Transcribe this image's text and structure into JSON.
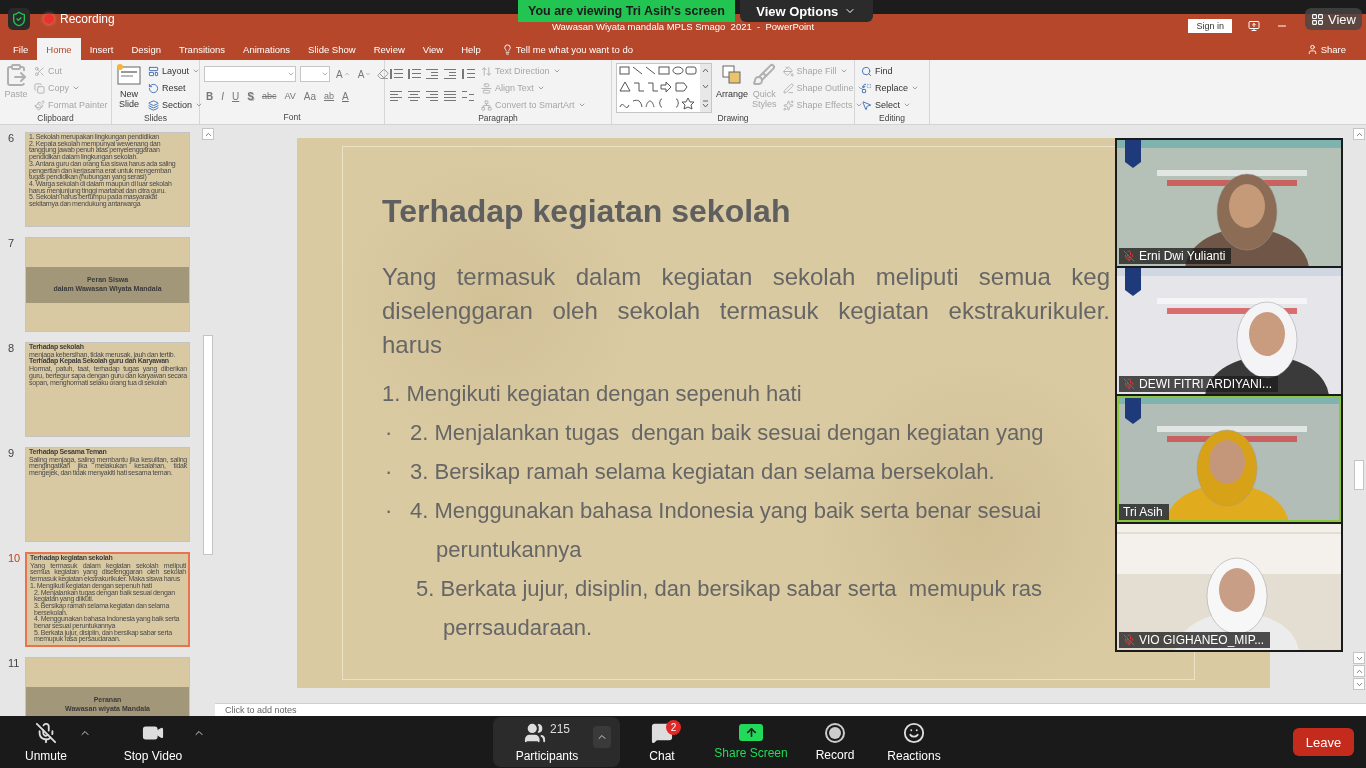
{
  "zoom_banner": {
    "viewing": "You are viewing Tri Asih's screen",
    "view_options": "View Options"
  },
  "recording": {
    "label": "Recording"
  },
  "view_button": {
    "label": "View"
  },
  "title_bar": {
    "title": "Wawasan Wiyata mandala MPLS Smago  2021  -  PowerPoint",
    "sign_in": "Sign in"
  },
  "menu_tabs": [
    {
      "label": "File",
      "selected": false
    },
    {
      "label": "Home",
      "selected": true
    },
    {
      "label": "Insert",
      "selected": false
    },
    {
      "label": "Design",
      "selected": false
    },
    {
      "label": "Transitions",
      "selected": false
    },
    {
      "label": "Animations",
      "selected": false
    },
    {
      "label": "Slide Show",
      "selected": false
    },
    {
      "label": "Review",
      "selected": false
    },
    {
      "label": "View",
      "selected": false
    },
    {
      "label": "Help",
      "selected": false
    }
  ],
  "tell_me": {
    "label": "Tell me what you want to do"
  },
  "share": {
    "label": "Share"
  },
  "ribbon": {
    "groups": [
      {
        "kind": "clipboard",
        "label": "Clipboard",
        "large": [
          {
            "kind": "paste",
            "label": "Paste",
            "disabled": true
          }
        ],
        "small": [
          {
            "kind": "cut",
            "label": "Cut",
            "disabled": true,
            "menu": false
          },
          {
            "kind": "copy",
            "label": "Copy",
            "disabled": true,
            "menu": true
          },
          {
            "kind": "format_painter",
            "label": "Format Painter",
            "disabled": true,
            "menu": false
          }
        ]
      },
      {
        "kind": "slides",
        "label": "Slides",
        "large": [
          {
            "kind": "new_slide",
            "label": "New Slide",
            "disabled": false
          }
        ],
        "small": [
          {
            "kind": "layout",
            "label": "Layout",
            "disabled": false,
            "menu": true
          },
          {
            "kind": "reset",
            "label": "Reset",
            "disabled": false,
            "menu": false
          },
          {
            "kind": "section",
            "label": "Section",
            "disabled": false,
            "menu": true
          }
        ]
      },
      {
        "kind": "font",
        "label": "Font",
        "size_buttons": [
          "A",
          "A"
        ],
        "format_buttons": [
          {
            "kind": "bold",
            "label": "B"
          },
          {
            "kind": "italic",
            "label": "I"
          },
          {
            "kind": "underline",
            "label": "U"
          },
          {
            "kind": "shadow",
            "label": "S"
          },
          {
            "kind": "strike",
            "label": "abc"
          },
          {
            "kind": "spacing",
            "label": "AV"
          },
          {
            "kind": "case",
            "label": "Aa"
          },
          {
            "kind": "highlight",
            "label": "ab"
          },
          {
            "kind": "color",
            "label": "A"
          }
        ]
      },
      {
        "kind": "paragraph",
        "label": "Paragraph",
        "small": [
          {
            "kind": "text_direction",
            "label": "Text Direction",
            "disabled": true,
            "menu": true
          },
          {
            "kind": "align_text",
            "label": "Align Text",
            "disabled": true,
            "menu": true
          },
          {
            "kind": "smartart",
            "label": "Convert to SmartArt",
            "disabled": true,
            "menu": true
          }
        ]
      },
      {
        "kind": "drawing",
        "label": "Drawing",
        "large": [
          {
            "kind": "arrange",
            "label": "Arrange",
            "disabled": false
          },
          {
            "kind": "quick_styles",
            "label": "Quick Styles",
            "disabled": true
          }
        ],
        "small": [
          {
            "kind": "shape_fill",
            "label": "Shape Fill",
            "disabled": true,
            "menu": true
          },
          {
            "kind": "shape_outline",
            "label": "Shape Outline",
            "disabled": true,
            "menu": true
          },
          {
            "kind": "shape_effects",
            "label": "Shape Effects",
            "disabled": true,
            "menu": true
          }
        ]
      },
      {
        "kind": "editing",
        "label": "Editing",
        "small": [
          {
            "kind": "find",
            "label": "Find",
            "disabled": false,
            "menu": false
          },
          {
            "kind": "replace",
            "label": "Replace",
            "disabled": false,
            "menu": true
          },
          {
            "kind": "select",
            "label": "Select",
            "disabled": false,
            "menu": true
          }
        ]
      }
    ]
  },
  "thumbnails": [
    {
      "number": "6",
      "selected": false,
      "kind": "content",
      "blocks": [
        {
          "kind": "item",
          "text": "1. Sekolah merupakan lingkungan pendidikan"
        },
        {
          "kind": "item",
          "text": "2. Kepala sekolah mempunyai wewenang dan tanggung jawab penuh atas    penyelenggaraan pendidikan dalam lingkungan sekolah."
        },
        {
          "kind": "item",
          "text": "3. Antara guru dan orang tua siswa harus ada saling pengertian dan kerjasama erat untuk mengemban tugas pendidikan (hubungan yang serasi)"
        },
        {
          "kind": "item",
          "text": "4. Warga sekolah di dalam maupun di luar sekolah harus menjunjung tinggi martabat dan citra guru."
        },
        {
          "kind": "item",
          "text": "5. Sekolah harus bertumpu pada masyarakat sekitarnya dan mendukung antarwarga"
        }
      ]
    },
    {
      "number": "7",
      "selected": false,
      "kind": "section",
      "blocks": [
        {
          "kind": "heading",
          "text": "Peran Siswa"
        },
        {
          "kind": "heading",
          "text": "dalam Wawasan Wiyata Mandala"
        }
      ]
    },
    {
      "number": "8",
      "selected": false,
      "kind": "content",
      "blocks": [
        {
          "kind": "heading",
          "text": "Terhadap sekolah"
        },
        {
          "kind": "body",
          "text": "menjaga kebersihan, tidak merusak, jauh dan tertib."
        },
        {
          "kind": "heading",
          "text": "Terhadap Kepala Sekolah guru dan Karyawan"
        },
        {
          "kind": "body",
          "text": "Hormat, patuh, taat, terhadap tugas yang diberikan guru, bertegur sapa dengan guru dan karyawan secara sopan, menghormati selaku orang tua di sekolah"
        }
      ]
    },
    {
      "number": "9",
      "selected": false,
      "kind": "content",
      "blocks": [
        {
          "kind": "heading",
          "text": "Terhadap Sesama Teman"
        },
        {
          "kind": "body",
          "text": "Saling menjaga, saling membantu jika kesulitan, saling mengingatkan jika melakukan kesalahan, tidak mengejek, dan tidak menyakiti hati sesama teman."
        }
      ]
    },
    {
      "number": "10",
      "selected": true,
      "kind": "content",
      "blocks": [
        {
          "kind": "heading",
          "text": "Terhadap kegiatan sekolah"
        },
        {
          "kind": "body",
          "text": "Yang termasuk dalam kegiatan sekolah meliputi semua kegiatan yang diselenggaran oleh sekolah termasuk kegiatan ekstrakurikuler. Maka siswa harus"
        },
        {
          "kind": "item",
          "text": "1. Mengikuti kegiatan dengan sepenuh hati"
        },
        {
          "kind": "subitem",
          "text": "2. Menjalankan tugas dengan baik sesuai dengan kegiatan yang diikuti."
        },
        {
          "kind": "subitem",
          "text": "3. Bersikap ramah selama kegiatan dan selama bersekolah."
        },
        {
          "kind": "subitem",
          "text": "4. Menggunakan bahasa Indonesia yang baik serta benar sesuai peruntukannya"
        },
        {
          "kind": "subitem",
          "text": "5. Berkata jujur, disiplin, dan bersikap sabar serta memupuk rasa persaudaraan."
        }
      ]
    },
    {
      "number": "11",
      "selected": false,
      "kind": "section",
      "blocks": [
        {
          "kind": "heading",
          "text": "Peranan"
        },
        {
          "kind": "heading",
          "text": "Wawasan wiyata Mandala"
        }
      ]
    }
  ],
  "slide": {
    "title": "Terhadap kegiatan sekolah",
    "paragraph": [
      {
        "kind": "justified",
        "text": "Yang termasuk dalam kegiatan sekolah meliputi semua keg"
      },
      {
        "kind": "justified",
        "text": "diselenggaran oleh sekolah termasuk kegiatan ekstrakurikuler."
      },
      {
        "kind": "last",
        "text": "harus"
      }
    ],
    "items": [
      {
        "kind": "numbered",
        "text": "1. Mengikuti kegiatan dengan sepenuh hati"
      },
      {
        "kind": "bulleted",
        "bullet": "·",
        "text": "2. Menjalankan tugas  dengan baik sesuai dengan kegiatan yang"
      },
      {
        "kind": "bulleted",
        "bullet": "·",
        "text": "3. Bersikap ramah selama kegiatan dan selama bersekolah."
      },
      {
        "kind": "bulleted",
        "bullet": "·",
        "text": "4. Menggunakan bahasa Indonesia yang baik serta benar sesuai"
      },
      {
        "kind": "wrapped",
        "text": "peruntukannya"
      },
      {
        "kind": "indented",
        "text": "5. Berkata jujur, disiplin, dan bersikap sabar serta  memupuk ras"
      },
      {
        "kind": "indented_wrap",
        "text": "perrsaudaraan."
      }
    ]
  },
  "notes": {
    "placeholder": "Click to add notes"
  },
  "video_tiles": [
    {
      "name": "Erni Dwi Yulianti",
      "muted": true,
      "speaking": false
    },
    {
      "name": "DEWI FITRI ARDIYANI...",
      "muted": true,
      "speaking": false
    },
    {
      "name": "Tri Asih",
      "muted": false,
      "speaking": true
    },
    {
      "name": "VIO GIGHANEO_MIP...",
      "muted": true,
      "speaking": false
    }
  ],
  "meeting_toolbar": {
    "left": [
      {
        "kind": "mic",
        "label": "Unmute",
        "muted": true
      },
      {
        "kind": "camera",
        "label": "Stop Video"
      }
    ],
    "center": [
      {
        "kind": "participants",
        "label": "Participants",
        "count": "215"
      },
      {
        "kind": "chat",
        "label": "Chat",
        "badge": "2"
      },
      {
        "kind": "share",
        "label": "Share Screen"
      },
      {
        "kind": "record",
        "label": "Record"
      },
      {
        "kind": "reactions",
        "label": "Reactions"
      }
    ],
    "leave": {
      "label": "Leave"
    }
  }
}
